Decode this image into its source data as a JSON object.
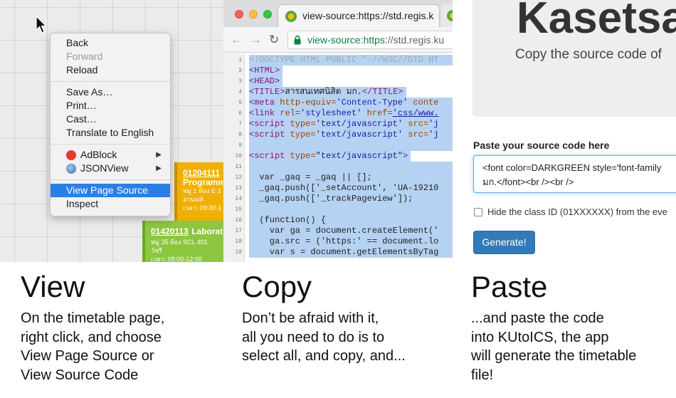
{
  "view_panel": {
    "context_menu": {
      "items": [
        {
          "label": "Back",
          "state": "normal"
        },
        {
          "label": "Forward",
          "state": "disabled"
        },
        {
          "label": "Reload",
          "state": "normal"
        },
        {
          "label": "Save As…",
          "state": "normal"
        },
        {
          "label": "Print…",
          "state": "normal"
        },
        {
          "label": "Cast…",
          "state": "normal"
        },
        {
          "label": "Translate to English",
          "state": "normal"
        },
        {
          "label": "AdBlock",
          "state": "submenu",
          "icon": "adblock-icon"
        },
        {
          "label": "JSONView",
          "state": "submenu",
          "icon": "jsonview-icon"
        },
        {
          "label": "View Page Source",
          "state": "highlighted"
        },
        {
          "label": "Inspect",
          "state": "normal"
        }
      ]
    },
    "courses": [
      {
        "code": "01204111",
        "name": "Programm",
        "room": "หมู่ 1 ห้อง E 2",
        "teacher": "อานนท์",
        "time": "เวลา: 09:30-1"
      },
      {
        "code": "01420113",
        "name": "Laborat",
        "room": "หมู่ 35 ห้อง SCL 401",
        "teacher": "วัชรี",
        "time": "เวลา: 09:00-12:00"
      }
    ],
    "caption_title": "View",
    "caption_text": "On the timetable page,\nright click, and choose\nView Page Source or\nView Source Code"
  },
  "copy_panel": {
    "tab_title": "view-source:https://std.regis.k",
    "url_scheme": "view-source:https",
    "url_rest": "://std.regis.ku",
    "caption_title": "Copy",
    "caption_text": "Don’t be afraid with it,\nall you need to do is to\nselect all, and copy, and..."
  },
  "paste_panel": {
    "hero_title": "Kasetsa",
    "hero_subtitle": "Copy the source code of",
    "paste_label": "Paste your source code here",
    "paste_value": "<font color=DARKGREEN style='font-family\nมก.</font><br /><br />",
    "checkbox_label": "Hide the class ID (01XXXXXX) from the eve",
    "generate_label": "Generate!",
    "caption_title": "Paste",
    "caption_text": "...and paste the code\ninto KUtoICS, the app\nwill generate the timetable\nfile!"
  },
  "colors": {
    "menu_highlight": "#2b7fe4",
    "course_yellow": "#f0b000",
    "course_green": "#8dc63f",
    "selection": "#b6d2f2",
    "button_primary": "#337ab7"
  }
}
